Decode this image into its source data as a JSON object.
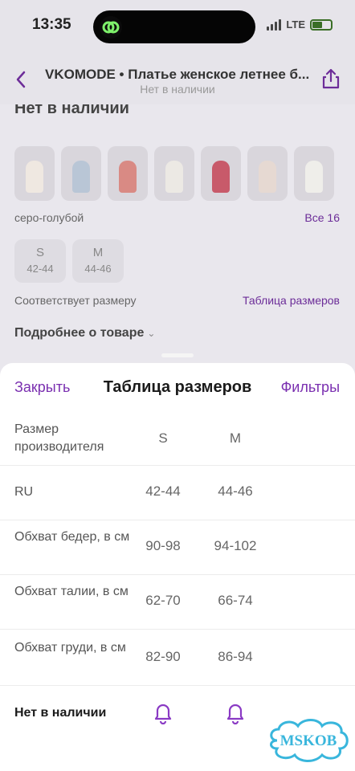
{
  "status": {
    "time": "13:35",
    "network": "LTE"
  },
  "header": {
    "title": "VKOMODE • Платье женское летнее б...",
    "subtitle": "Нет в наличии"
  },
  "page": {
    "out_of_stock": "Нет в наличии",
    "color_label": "серо-голубой",
    "all_colors": "Все 16",
    "sizes": [
      {
        "size": "S",
        "range": "42-44"
      },
      {
        "size": "M",
        "range": "44-46"
      }
    ],
    "fit": "Соответствует размеру",
    "size_table_link": "Таблица размеров",
    "more": "Подробнее о товаре"
  },
  "sheet": {
    "close": "Закрыть",
    "title": "Таблица размеров",
    "filters": "Фильтры",
    "rows": [
      {
        "label": "Размер производителя",
        "s": "S",
        "m": "M"
      },
      {
        "label": "RU",
        "s": "42-44",
        "m": "44-46"
      },
      {
        "label": "Обхват бедер, в см",
        "s": "90-98",
        "m": "94-102"
      },
      {
        "label": "Обхват талии, в см",
        "s": "62-70",
        "m": "66-74"
      },
      {
        "label": "Обхват груди, в см",
        "s": "82-90",
        "m": "86-94"
      }
    ],
    "footer_label": "Нет в наличии"
  },
  "watermark": "MSKOB",
  "colors": {
    "accent": "#7a2fb0",
    "sheet_bg": "#ffffff",
    "dim_bg": "#e9e7ed"
  }
}
